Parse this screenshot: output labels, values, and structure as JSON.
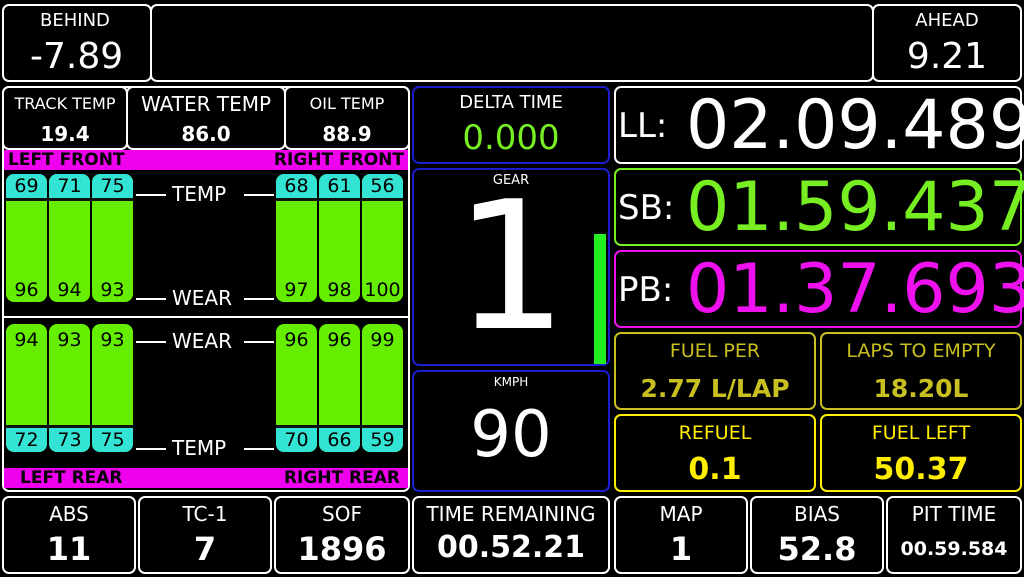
{
  "top": {
    "behind_label": "BEHIND",
    "behind_value": "-7.89",
    "ahead_label": "AHEAD",
    "ahead_value": "9.21"
  },
  "temps": {
    "track_label": "TRACK TEMP",
    "track_value": "19.4",
    "water_label": "WATER TEMP",
    "water_value": "86.0",
    "oil_label": "OIL TEMP",
    "oil_value": "88.9"
  },
  "tyres": {
    "left_front_label": "LEFT FRONT",
    "right_front_label": "RIGHT FRONT",
    "left_rear_label": "LEFT REAR",
    "right_rear_label": "RIGHT REAR",
    "temp_label": "TEMP",
    "wear_label": "WEAR",
    "lf_temps": [
      "69",
      "71",
      "75"
    ],
    "lf_wear": [
      "96",
      "94",
      "93"
    ],
    "rf_temps": [
      "68",
      "61",
      "56"
    ],
    "rf_wear": [
      "97",
      "98",
      "100"
    ],
    "lr_wear": [
      "94",
      "93",
      "93"
    ],
    "lr_temps": [
      "72",
      "73",
      "75"
    ],
    "rr_wear": [
      "96",
      "96",
      "99"
    ],
    "rr_temps": [
      "70",
      "66",
      "59"
    ],
    "colors": {
      "temp_cap": "#33e3d3",
      "wear_fill": "#66ee00",
      "banner": "#ee00ee"
    }
  },
  "center": {
    "delta_label": "DELTA TIME",
    "delta_value": "0.000",
    "gear_label": "GEAR",
    "gear_value": "1",
    "speed_label": "KMPH",
    "speed_value": "90"
  },
  "laps": {
    "ll_label": "LL:",
    "ll_value": "02.09.489",
    "sb_label": "SB:",
    "sb_value": "01.59.437",
    "pb_label": "PB:",
    "pb_value": "01.37.693",
    "colors": {
      "sb": "#77ee22",
      "pb": "#ee11ee"
    }
  },
  "fuel": {
    "per_label": "FUEL PER",
    "per_value": "2.77 L/LAP",
    "empty_label": "LAPS TO EMPTY",
    "empty_value": "18.20L",
    "refuel_label": "REFUEL",
    "refuel_value": "0.1",
    "left_label": "FUEL LEFT",
    "left_value": "50.37",
    "colors": {
      "dim": "#c8c020",
      "bright": "#ffee00"
    }
  },
  "bottom": {
    "abs_label": "ABS",
    "abs_value": "11",
    "tc_label": "TC-1",
    "tc_value": "7",
    "sof_label": "SOF",
    "sof_value": "1896",
    "time_label": "TIME REMAINING",
    "time_value": "00.52.21",
    "map_label": "MAP",
    "map_value": "1",
    "bias_label": "BIAS",
    "bias_value": "52.8",
    "pit_label": "PIT TIME",
    "pit_value": "00.59.584"
  }
}
